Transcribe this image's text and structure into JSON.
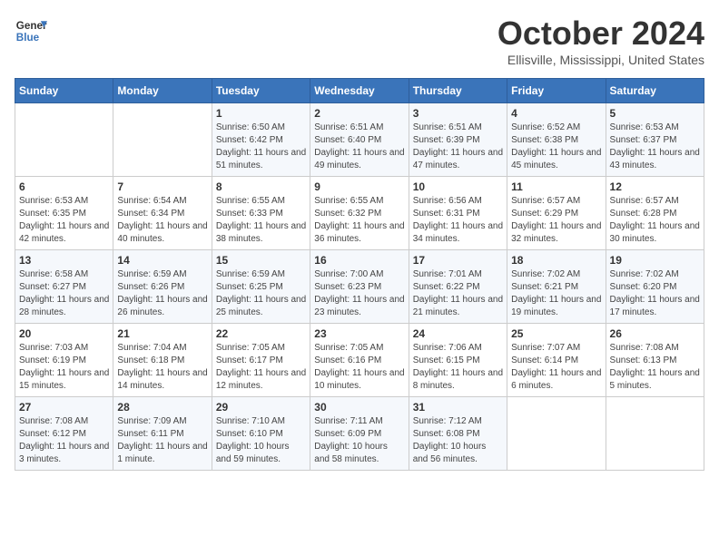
{
  "header": {
    "logo_line1": "General",
    "logo_line2": "Blue",
    "month_title": "October 2024",
    "subtitle": "Ellisville, Mississippi, United States"
  },
  "days_of_week": [
    "Sunday",
    "Monday",
    "Tuesday",
    "Wednesday",
    "Thursday",
    "Friday",
    "Saturday"
  ],
  "weeks": [
    [
      {
        "day": "",
        "sunrise": "",
        "sunset": "",
        "daylight": ""
      },
      {
        "day": "",
        "sunrise": "",
        "sunset": "",
        "daylight": ""
      },
      {
        "day": "1",
        "sunrise": "Sunrise: 6:50 AM",
        "sunset": "Sunset: 6:42 PM",
        "daylight": "Daylight: 11 hours and 51 minutes."
      },
      {
        "day": "2",
        "sunrise": "Sunrise: 6:51 AM",
        "sunset": "Sunset: 6:40 PM",
        "daylight": "Daylight: 11 hours and 49 minutes."
      },
      {
        "day": "3",
        "sunrise": "Sunrise: 6:51 AM",
        "sunset": "Sunset: 6:39 PM",
        "daylight": "Daylight: 11 hours and 47 minutes."
      },
      {
        "day": "4",
        "sunrise": "Sunrise: 6:52 AM",
        "sunset": "Sunset: 6:38 PM",
        "daylight": "Daylight: 11 hours and 45 minutes."
      },
      {
        "day": "5",
        "sunrise": "Sunrise: 6:53 AM",
        "sunset": "Sunset: 6:37 PM",
        "daylight": "Daylight: 11 hours and 43 minutes."
      }
    ],
    [
      {
        "day": "6",
        "sunrise": "Sunrise: 6:53 AM",
        "sunset": "Sunset: 6:35 PM",
        "daylight": "Daylight: 11 hours and 42 minutes."
      },
      {
        "day": "7",
        "sunrise": "Sunrise: 6:54 AM",
        "sunset": "Sunset: 6:34 PM",
        "daylight": "Daylight: 11 hours and 40 minutes."
      },
      {
        "day": "8",
        "sunrise": "Sunrise: 6:55 AM",
        "sunset": "Sunset: 6:33 PM",
        "daylight": "Daylight: 11 hours and 38 minutes."
      },
      {
        "day": "9",
        "sunrise": "Sunrise: 6:55 AM",
        "sunset": "Sunset: 6:32 PM",
        "daylight": "Daylight: 11 hours and 36 minutes."
      },
      {
        "day": "10",
        "sunrise": "Sunrise: 6:56 AM",
        "sunset": "Sunset: 6:31 PM",
        "daylight": "Daylight: 11 hours and 34 minutes."
      },
      {
        "day": "11",
        "sunrise": "Sunrise: 6:57 AM",
        "sunset": "Sunset: 6:29 PM",
        "daylight": "Daylight: 11 hours and 32 minutes."
      },
      {
        "day": "12",
        "sunrise": "Sunrise: 6:57 AM",
        "sunset": "Sunset: 6:28 PM",
        "daylight": "Daylight: 11 hours and 30 minutes."
      }
    ],
    [
      {
        "day": "13",
        "sunrise": "Sunrise: 6:58 AM",
        "sunset": "Sunset: 6:27 PM",
        "daylight": "Daylight: 11 hours and 28 minutes."
      },
      {
        "day": "14",
        "sunrise": "Sunrise: 6:59 AM",
        "sunset": "Sunset: 6:26 PM",
        "daylight": "Daylight: 11 hours and 26 minutes."
      },
      {
        "day": "15",
        "sunrise": "Sunrise: 6:59 AM",
        "sunset": "Sunset: 6:25 PM",
        "daylight": "Daylight: 11 hours and 25 minutes."
      },
      {
        "day": "16",
        "sunrise": "Sunrise: 7:00 AM",
        "sunset": "Sunset: 6:23 PM",
        "daylight": "Daylight: 11 hours and 23 minutes."
      },
      {
        "day": "17",
        "sunrise": "Sunrise: 7:01 AM",
        "sunset": "Sunset: 6:22 PM",
        "daylight": "Daylight: 11 hours and 21 minutes."
      },
      {
        "day": "18",
        "sunrise": "Sunrise: 7:02 AM",
        "sunset": "Sunset: 6:21 PM",
        "daylight": "Daylight: 11 hours and 19 minutes."
      },
      {
        "day": "19",
        "sunrise": "Sunrise: 7:02 AM",
        "sunset": "Sunset: 6:20 PM",
        "daylight": "Daylight: 11 hours and 17 minutes."
      }
    ],
    [
      {
        "day": "20",
        "sunrise": "Sunrise: 7:03 AM",
        "sunset": "Sunset: 6:19 PM",
        "daylight": "Daylight: 11 hours and 15 minutes."
      },
      {
        "day": "21",
        "sunrise": "Sunrise: 7:04 AM",
        "sunset": "Sunset: 6:18 PM",
        "daylight": "Daylight: 11 hours and 14 minutes."
      },
      {
        "day": "22",
        "sunrise": "Sunrise: 7:05 AM",
        "sunset": "Sunset: 6:17 PM",
        "daylight": "Daylight: 11 hours and 12 minutes."
      },
      {
        "day": "23",
        "sunrise": "Sunrise: 7:05 AM",
        "sunset": "Sunset: 6:16 PM",
        "daylight": "Daylight: 11 hours and 10 minutes."
      },
      {
        "day": "24",
        "sunrise": "Sunrise: 7:06 AM",
        "sunset": "Sunset: 6:15 PM",
        "daylight": "Daylight: 11 hours and 8 minutes."
      },
      {
        "day": "25",
        "sunrise": "Sunrise: 7:07 AM",
        "sunset": "Sunset: 6:14 PM",
        "daylight": "Daylight: 11 hours and 6 minutes."
      },
      {
        "day": "26",
        "sunrise": "Sunrise: 7:08 AM",
        "sunset": "Sunset: 6:13 PM",
        "daylight": "Daylight: 11 hours and 5 minutes."
      }
    ],
    [
      {
        "day": "27",
        "sunrise": "Sunrise: 7:08 AM",
        "sunset": "Sunset: 6:12 PM",
        "daylight": "Daylight: 11 hours and 3 minutes."
      },
      {
        "day": "28",
        "sunrise": "Sunrise: 7:09 AM",
        "sunset": "Sunset: 6:11 PM",
        "daylight": "Daylight: 11 hours and 1 minute."
      },
      {
        "day": "29",
        "sunrise": "Sunrise: 7:10 AM",
        "sunset": "Sunset: 6:10 PM",
        "daylight": "Daylight: 10 hours and 59 minutes."
      },
      {
        "day": "30",
        "sunrise": "Sunrise: 7:11 AM",
        "sunset": "Sunset: 6:09 PM",
        "daylight": "Daylight: 10 hours and 58 minutes."
      },
      {
        "day": "31",
        "sunrise": "Sunrise: 7:12 AM",
        "sunset": "Sunset: 6:08 PM",
        "daylight": "Daylight: 10 hours and 56 minutes."
      },
      {
        "day": "",
        "sunrise": "",
        "sunset": "",
        "daylight": ""
      },
      {
        "day": "",
        "sunrise": "",
        "sunset": "",
        "daylight": ""
      }
    ]
  ]
}
